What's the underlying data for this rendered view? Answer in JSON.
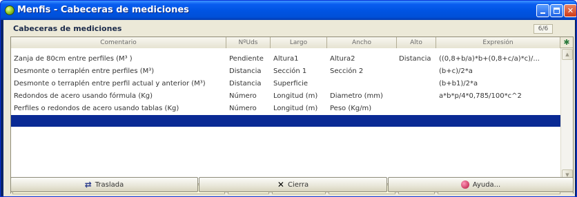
{
  "window": {
    "title": "Menfis - Cabeceras de mediciones"
  },
  "panel": {
    "caption": "Cabeceras de mediciones",
    "counter": "6/6"
  },
  "table": {
    "headers": [
      "Comentario",
      "NºUds",
      "Largo",
      "Ancho",
      "Alto",
      "Expresión"
    ],
    "rows": [
      {
        "comentario": "Zanja de 80cm entre perfiles (M³ )",
        "uds": "Pendiente",
        "largo": "Altura1",
        "ancho": "Altura2",
        "alto": "Distancia",
        "expresion": "((0,8+b/a)*b+(0,8+c/a)*c)/..."
      },
      {
        "comentario": "Desmonte o terraplén entre perfiles (M³)",
        "uds": "Distancia",
        "largo": "Sección 1",
        "ancho": "Sección 2",
        "alto": "",
        "expresion": "(b+c)/2*a"
      },
      {
        "comentario": "Desmonte o terraplén entre perfil actual y anterior (M³)",
        "uds": "Distancia",
        "largo": "Superficie",
        "ancho": "",
        "alto": "",
        "expresion": "(b+b1)/2*a"
      },
      {
        "comentario": "Redondos de acero usando fórmula (Kg)",
        "uds": "Número",
        "largo": "Longitud (m)",
        "ancho": "Diametro (mm)",
        "alto": "",
        "expresion": "a*b*p/4*0,785/100*c^2"
      },
      {
        "comentario": "Perfiles o redondos de acero usando tablas (Kg)",
        "uds": "Número",
        "largo": "Longitud (m)",
        "ancho": "Peso (Kg/m)",
        "alto": "",
        "expresion": ""
      }
    ]
  },
  "buttons": {
    "traslada": "Traslada",
    "cierra": "Cierra",
    "ayuda": "Ayuda..."
  },
  "icons": {
    "traslada": "move-icon",
    "cierra": "close-x-icon",
    "ayuda": "help-icon"
  },
  "colors": {
    "titlebar": "#0054e3",
    "selection": "#0a2a94",
    "edit_cell": "#fffde0"
  }
}
